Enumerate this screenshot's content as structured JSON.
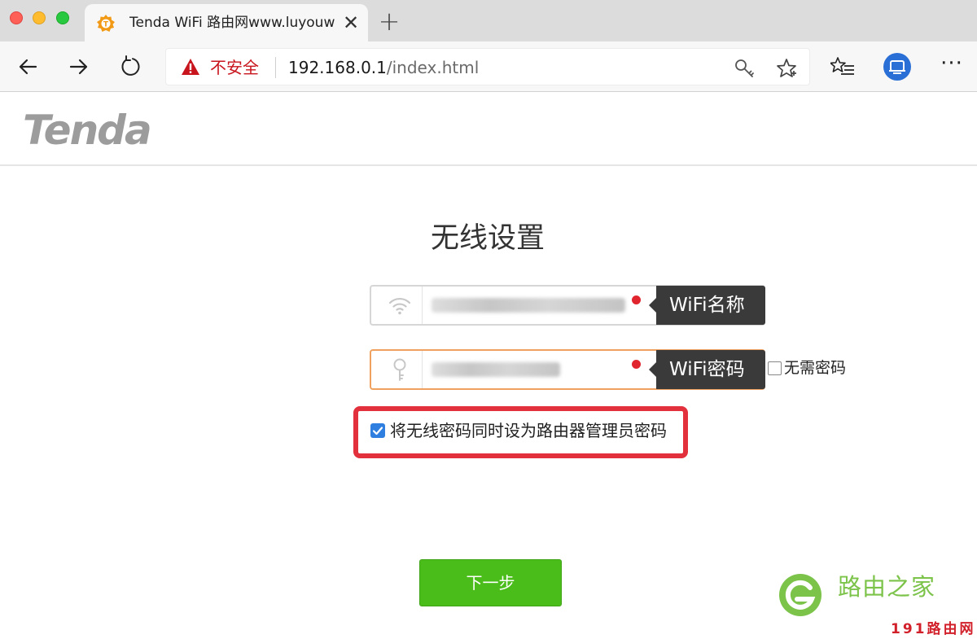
{
  "browser": {
    "tab_title": "Tenda WiFi 路由网www.luyouw",
    "tab_close": "✕",
    "new_tab": "+",
    "security_label": "不安全",
    "url_host": "192.168.0.1",
    "url_path": "/index.html",
    "more_menu": "···"
  },
  "page": {
    "logo_text": "Tenda",
    "title": "无线设置",
    "ssid_tag": "WiFi名称",
    "password_tag": "WiFi密码",
    "no_password_label": "无需密码",
    "sync_admin_label": "将无线密码同时设为路由器管理员密码",
    "sync_admin_checked": true,
    "next_button": "下一步"
  },
  "watermark": {
    "brand": "路由之家",
    "site": "191路由网"
  },
  "colors": {
    "accent_green": "#4bbd1b",
    "highlight_red": "#e2303d",
    "checkbox_blue": "#2f7fe0",
    "password_border": "#f0a160"
  }
}
